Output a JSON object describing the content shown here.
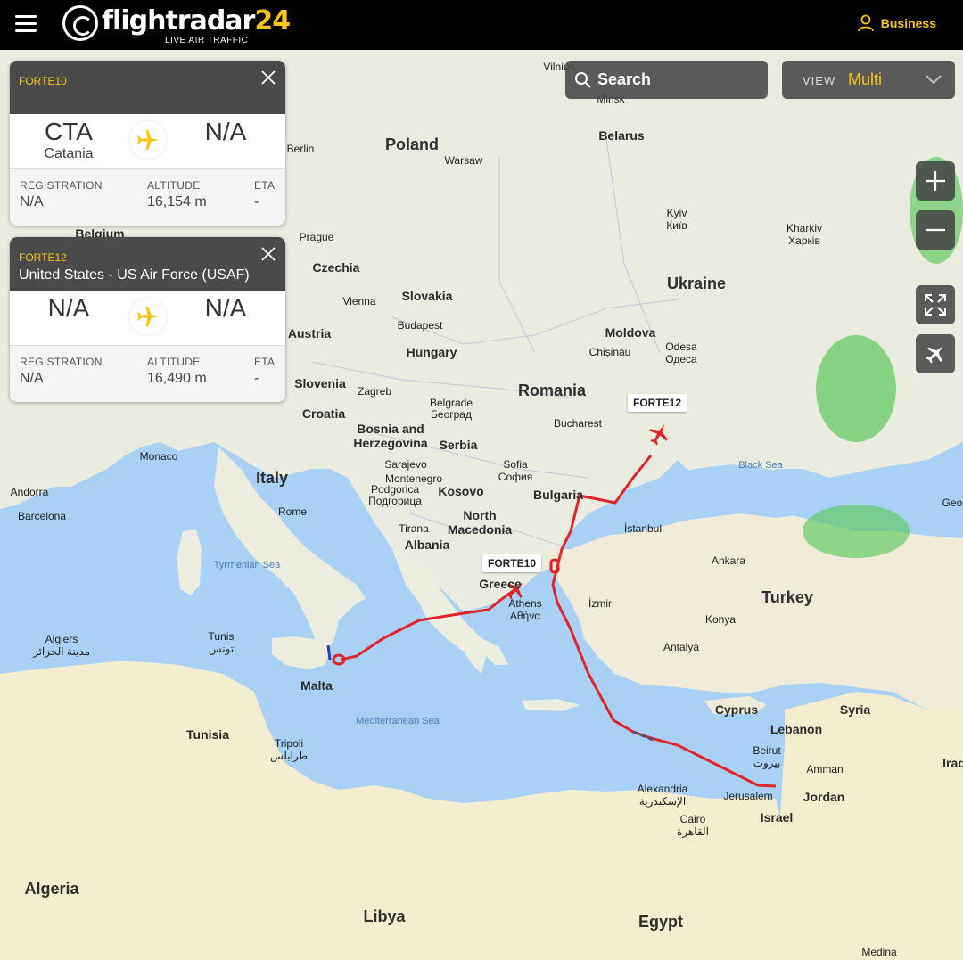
{
  "header": {
    "brand_name": "flightradar",
    "brand_number": "24",
    "brand_tagline": "LIVE AIR TRAFFIC",
    "business_label": "Business"
  },
  "search": {
    "placeholder": "Search"
  },
  "view": {
    "label": "VIEW",
    "value": "Multi"
  },
  "flights": [
    {
      "callsign": "FORTE10",
      "airline": "",
      "from_code": "CTA",
      "from_city": "Catania",
      "to_code": "N/A",
      "registration_label": "REGISTRATION",
      "registration": "N/A",
      "altitude_label": "ALTITUDE",
      "altitude": "16,154 m",
      "eta_label": "ETA",
      "eta": "-"
    },
    {
      "callsign": "FORTE12",
      "airline": "United States - US Air Force (USAF)",
      "from_code": "N/A",
      "from_city": "",
      "to_code": "N/A",
      "registration_label": "REGISTRATION",
      "registration": "N/A",
      "altitude_label": "ALTITUDE",
      "altitude": "16,490 m",
      "eta_label": "ETA",
      "eta": "-"
    }
  ],
  "map_callsigns": {
    "forte10": "FORTE10",
    "forte12": "FORTE12"
  },
  "map_labels": {
    "countries": {
      "poland": "Poland",
      "belarus": "Belarus",
      "ukraine": "Ukraine",
      "czechia": "Czechia",
      "slovakia": "Slovakia",
      "austria": "Austria",
      "hungary": "Hungary",
      "romania": "Romania",
      "moldova": "Moldova",
      "slovenia": "Slovenia",
      "croatia": "Croatia",
      "bosnia": "Bosnia and\nHerzegovina",
      "serbia": "Serbia",
      "montenegro": "Montenegro",
      "kosovo": "Kosovo",
      "north_macedonia": "North\nMacedonia",
      "albania": "Albania",
      "bulgaria": "Bulgaria",
      "greece": "Greece",
      "italy": "Italy",
      "turkey": "Turkey",
      "cyprus": "Cyprus",
      "syria": "Syria",
      "lebanon": "Lebanon",
      "israel": "Israel",
      "jordan": "Jordan",
      "iraq": "Iraq",
      "egypt": "Egypt",
      "libya": "Libya",
      "algeria": "Algeria",
      "tunisia": "Tunisia",
      "malta": "Malta",
      "belgium": "Belgium",
      "monaco": "Monaco",
      "andorra": "Andorra",
      "georgia_partial": "Geo"
    },
    "cities": {
      "vilnius": "Vilnius",
      "minsk": "Minsk",
      "berlin": "Berlin",
      "warsaw": "Warsaw",
      "kyiv": "Kyiv",
      "kyiv_local": "Київ",
      "kharkiv": "Kharkiv",
      "kharkiv_local": "Харків",
      "prague": "Prague",
      "vienna": "Vienna",
      "budapest": "Budapest",
      "chisinau": "Chișinău",
      "odesa": "Odesa",
      "odesa_local": "Одеса",
      "zagreb": "Zagreb",
      "belgrade": "Belgrade",
      "belgrade_local": "Београд",
      "bucharest": "Bucharest",
      "sarajevo": "Sarajevo",
      "sofia": "Sofia",
      "sofia_local": "София",
      "podgorica": "Podgorica",
      "podgorica_local": "Подгорица",
      "rome": "Rome",
      "tirana": "Tirana",
      "istanbul": "İstanbul",
      "ankara": "Ankara",
      "izmir": "İzmir",
      "konya": "Konya",
      "antalya": "Antalya",
      "athens": "Athens",
      "athens_local": "Αθήνα",
      "barcelona": "Barcelona",
      "algiers": "Algiers",
      "algiers_local": "مدينة الجزائر",
      "tunis": "Tunis",
      "tunis_local": "تونس",
      "tripoli": "Tripoli",
      "tripoli_local": "طرابلس",
      "beirut": "Beirut",
      "beirut_local": "بيروت",
      "amman": "Amman",
      "jerusalem": "Jerusalem",
      "alexandria": "Alexandria",
      "alexandria_local": "الإسكندرية",
      "cairo": "Cairo",
      "cairo_local": "القاهرة",
      "medina": "Medina"
    },
    "seas": {
      "tyrrhenian": "Tyrrhenian Sea",
      "mediterranean": "Mediterranean Sea",
      "black": "Black Sea"
    }
  }
}
